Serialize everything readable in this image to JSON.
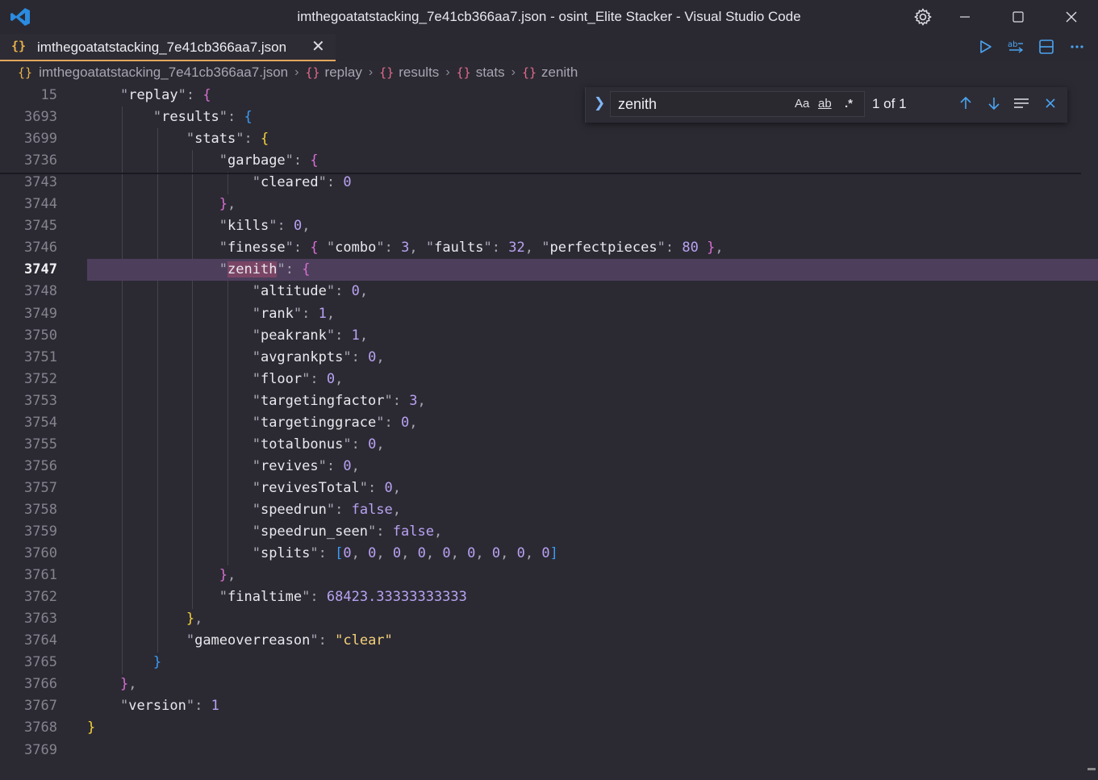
{
  "window": {
    "title": "imthegoatatstacking_7e41cb366aa7.json - osint_Elite Stacker - Visual Studio Code"
  },
  "tab": {
    "icon": "{}",
    "label": "imthegoatatstacking_7e41cb366aa7.json",
    "close": "✕"
  },
  "breadcrumb": {
    "file": "imthegoatatstacking_7e41cb366aa7.json",
    "items": [
      "replay",
      "results",
      "stats",
      "zenith"
    ]
  },
  "find": {
    "query": "zenith",
    "match_case": "Aa",
    "whole_word": "ab",
    "regex": ".*",
    "count": "1 of 1"
  },
  "colors": {
    "accent": "#e2a85c",
    "current_line": "#4d3f5c",
    "find_highlight": "#7a4565"
  },
  "icons": [
    "vscode-logo-icon",
    "gear-icon",
    "minimize-icon",
    "maximize-icon",
    "close-icon",
    "run-icon",
    "compare-icon",
    "split-editor-icon",
    "more-icon",
    "arrow-up-icon",
    "arrow-down-icon",
    "find-in-selection-icon"
  ],
  "editor": {
    "active_line": "3747",
    "lines": [
      {
        "num": "15",
        "code": "    \"replay\": {"
      },
      {
        "num": "3693",
        "code": "        \"results\": {"
      },
      {
        "num": "3699",
        "code": "            \"stats\": {"
      },
      {
        "num": "3736",
        "code": "                \"garbage\": {"
      },
      {
        "num": "3743",
        "code": "                    \"cleared\": 0"
      },
      {
        "num": "3744",
        "code": "                },"
      },
      {
        "num": "3745",
        "code": "                \"kills\": 0,"
      },
      {
        "num": "3746",
        "code": "                \"finesse\": { \"combo\": 3, \"faults\": 32, \"perfectpieces\": 80 },"
      },
      {
        "num": "3747",
        "code": "                \"zenith\": {"
      },
      {
        "num": "3748",
        "code": "                    \"altitude\": 0,"
      },
      {
        "num": "3749",
        "code": "                    \"rank\": 1,"
      },
      {
        "num": "3750",
        "code": "                    \"peakrank\": 1,"
      },
      {
        "num": "3751",
        "code": "                    \"avgrankpts\": 0,"
      },
      {
        "num": "3752",
        "code": "                    \"floor\": 0,"
      },
      {
        "num": "3753",
        "code": "                    \"targetingfactor\": 3,"
      },
      {
        "num": "3754",
        "code": "                    \"targetinggrace\": 0,"
      },
      {
        "num": "3755",
        "code": "                    \"totalbonus\": 0,"
      },
      {
        "num": "3756",
        "code": "                    \"revives\": 0,"
      },
      {
        "num": "3757",
        "code": "                    \"revivesTotal\": 0,"
      },
      {
        "num": "3758",
        "code": "                    \"speedrun\": false,"
      },
      {
        "num": "3759",
        "code": "                    \"speedrun_seen\": false,"
      },
      {
        "num": "3760",
        "code": "                    \"splits\": [0, 0, 0, 0, 0, 0, 0, 0, 0]"
      },
      {
        "num": "3761",
        "code": "                },"
      },
      {
        "num": "3762",
        "code": "                \"finaltime\": 68423.33333333333"
      },
      {
        "num": "3763",
        "code": "            },"
      },
      {
        "num": "3764",
        "code": "            \"gameoverreason\": \"clear\""
      },
      {
        "num": "3765",
        "code": "        }"
      },
      {
        "num": "3766",
        "code": "    },"
      },
      {
        "num": "3767",
        "code": "    \"version\": 1"
      },
      {
        "num": "3768",
        "code": "}"
      },
      {
        "num": "3769",
        "code": ""
      }
    ]
  }
}
